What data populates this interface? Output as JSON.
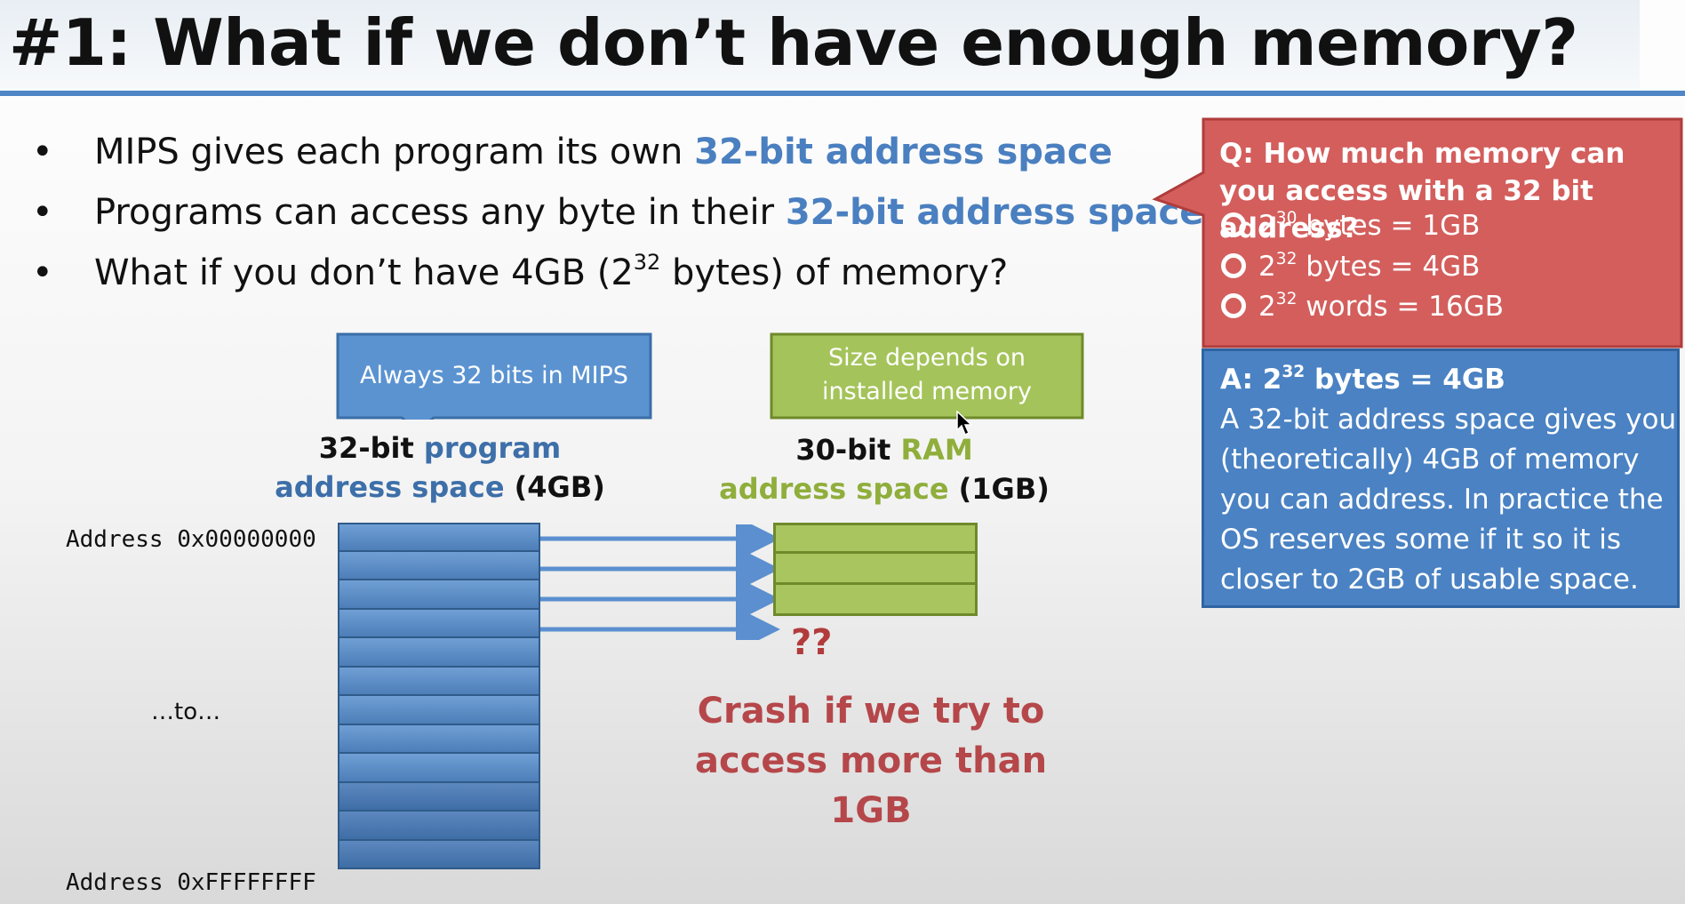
{
  "slide": {
    "title": "#1: What if we don’t have enough memory?",
    "bullets": [
      {
        "pre": "MIPS gives each program its own ",
        "highlight": "32-bit address space"
      },
      {
        "pre": "Programs can access any byte in their ",
        "highlight": "32-bit address space"
      },
      {
        "pre": "What if you don’t have 4GB (2",
        "sup": "32",
        "post": " bytes) of memory?"
      }
    ],
    "bullet_symbol": "•"
  },
  "diagram": {
    "left_callout": "Always 32 bits in MIPS",
    "right_callout_line1": "Size depends on",
    "right_callout_line2": "installed memory",
    "left_heading": {
      "bold": "32-bit ",
      "colored": "program",
      "line2_colored": "address space",
      "line2_rest": " (4GB)"
    },
    "right_heading": {
      "bold": "30-bit ",
      "colored": "RAM",
      "line2_colored": "address space",
      "line2_rest": " (1GB)"
    },
    "addr_start": "Address 0x00000000",
    "addr_mid": "…to…",
    "addr_end": "Address 0xFFFFFFFF",
    "question_marks": "??",
    "crash_line1": "Crash if we try to",
    "crash_line2": "access more than 1GB"
  },
  "quiz": {
    "question": "Q: How much memory can you access with a 32 bit address?",
    "options": [
      {
        "base": "2",
        "exp": "30",
        "rest": " bytes = 1GB"
      },
      {
        "base": "2",
        "exp": "32",
        "rest": " bytes = 4GB"
      },
      {
        "base": "2",
        "exp": "32",
        "rest": " words = 16GB"
      }
    ],
    "answer_head_base": "A: 2",
    "answer_head_exp": "32",
    "answer_head_rest": " bytes = 4GB",
    "answer_body": "A 32-bit address space gives you (theoretically) 4GB of memory you can address. In practice the OS reserves some if it so it is closer to 2GB of usable space."
  },
  "colors": {
    "title_rule": "#4f86c6",
    "highlight_blue": "#4a7fc0",
    "program_blue": "#4d7eb8",
    "ram_green": "#a9c55f",
    "question_red": "#d35e5c",
    "answer_blue": "#4a82c3",
    "crash_red": "#b5474a"
  }
}
